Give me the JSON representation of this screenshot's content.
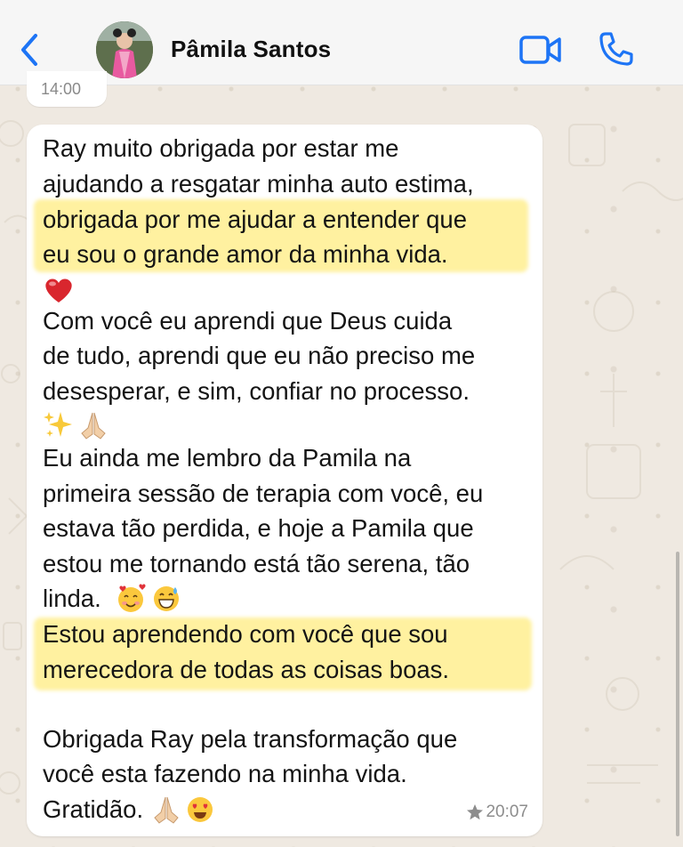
{
  "header": {
    "contact_name": "Pâmila Santos",
    "back_icon": "chevron-left-icon",
    "video_icon": "video-camera-icon",
    "call_icon": "phone-icon",
    "accent_color": "#1d74f5"
  },
  "previous_message": {
    "time": "14:00"
  },
  "message": {
    "lines": [
      "Ray muito obrigada por estar me",
      "ajudando a resgatar minha auto estima,",
      "obrigada por me ajudar a entender que",
      "eu sou o grande amor da minha vida.",
      "Com você eu aprendi que Deus cuida",
      "de tudo, aprendi que eu não preciso me",
      "desesperar, e sim, confiar no processo.",
      "Eu ainda me lembro da Pamila na",
      "primeira sessão de terapia com você, eu",
      "estava tão perdida, e hoje a Pamila que",
      "estou me tornando está tão serena, tão",
      "linda.",
      "Estou aprendendo com você que sou",
      "merecedora de todas as coisas boas.",
      "Obrigada Ray pela transformação que",
      "você esta fazendo na minha vida.",
      "Gratidão."
    ],
    "emojis": {
      "heart": "❤️",
      "sparkles": "✨",
      "pray": "🙏🏼",
      "smiling_hearts": "🥰",
      "sweat_smile": "😅",
      "heart_eyes": "😍"
    },
    "starred_icon": "star-icon",
    "time": "20:07",
    "highlight_color": "#fff1a0"
  }
}
